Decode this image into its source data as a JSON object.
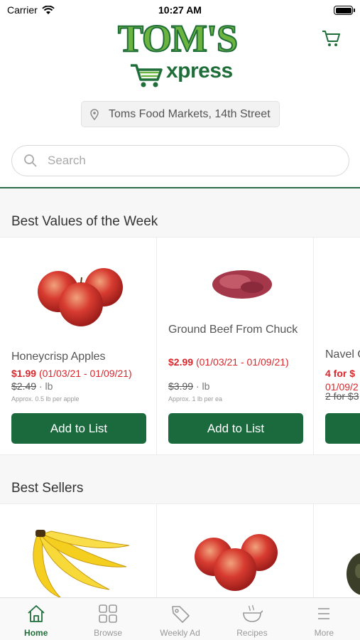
{
  "status": {
    "carrier": "Carrier",
    "time": "10:27 AM"
  },
  "brand": {
    "name": "TOM'S",
    "sub": "xpress"
  },
  "store": {
    "name": "Toms Food Markets, 14th Street"
  },
  "search": {
    "placeholder": "Search"
  },
  "sections": [
    {
      "title": "Best Values of the Week",
      "products": [
        {
          "name": "Honeycrisp Apples",
          "price": "$1.99",
          "dates": "(01/03/21 - 01/09/21)",
          "old_price": "$2.49",
          "unit": "lb",
          "approx": "Approx. 0.5 lb per apple",
          "button": "Add to List"
        },
        {
          "name": "Ground Beef From Chuck",
          "price": "$2.99",
          "dates": "(01/03/21 - 01/09/21)",
          "old_price": "$3.99",
          "unit": "lb",
          "approx": "Approx. 1 lb per ea",
          "button": "Add to List"
        },
        {
          "name": "Navel O",
          "price": "4 for $",
          "dates": "01/09/2",
          "old_price": "2 for $3",
          "unit": "",
          "approx": "",
          "button": ""
        }
      ]
    },
    {
      "title": "Best Sellers"
    }
  ],
  "tabs": [
    {
      "label": "Home",
      "icon": "home-icon",
      "active": true
    },
    {
      "label": "Browse",
      "icon": "grid-icon",
      "active": false
    },
    {
      "label": "Weekly Ad",
      "icon": "tag-icon",
      "active": false
    },
    {
      "label": "Recipes",
      "icon": "cooking-pot-icon",
      "active": false
    },
    {
      "label": "More",
      "icon": "menu-icon",
      "active": false
    }
  ],
  "colors": {
    "brand_green": "#1b6a3e",
    "light_green": "#6cb33f",
    "sale_red": "#d9262b"
  }
}
